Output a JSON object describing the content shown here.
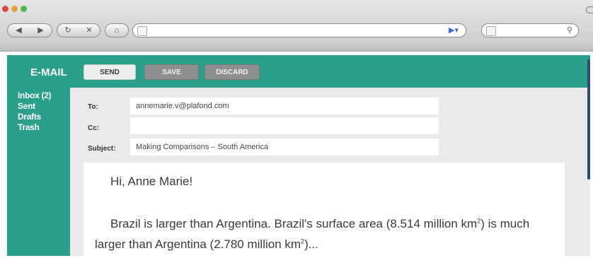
{
  "browser": {
    "nav_icons": [
      "back-icon",
      "forward-icon",
      "refresh-icon",
      "stop-icon",
      "home-icon"
    ],
    "address_value": "",
    "search_value": ""
  },
  "email_app": {
    "title": "E-MAIL",
    "buttons": {
      "send": "SEND",
      "save": "SAVE",
      "discard": "DISCARD"
    },
    "folders": [
      "Inbox (2)",
      "Sent",
      "Drafts",
      "Trash"
    ],
    "fields": {
      "to_label": "To:",
      "to_value": "annemarie.v@plafond.com",
      "cc_label": "Cc:",
      "cc_value": "",
      "subject_label": "Subject:",
      "subject_value": "Making Comparisons – South America"
    },
    "body": {
      "greeting": "Hi, Anne Marie!",
      "line1": "Brazil is larger than Argentina. Brazil's surface area (8.514 million km",
      "line1_sup": "2",
      "line1_tail": ")",
      "line2": "is much larger than Argentina (2.780 million km",
      "line2_sup": "2",
      "line2_tail": ")..."
    },
    "colors": {
      "accent": "#2a9f8a",
      "panel": "#eaeaea",
      "button_gray": "#8f8f8f"
    }
  }
}
